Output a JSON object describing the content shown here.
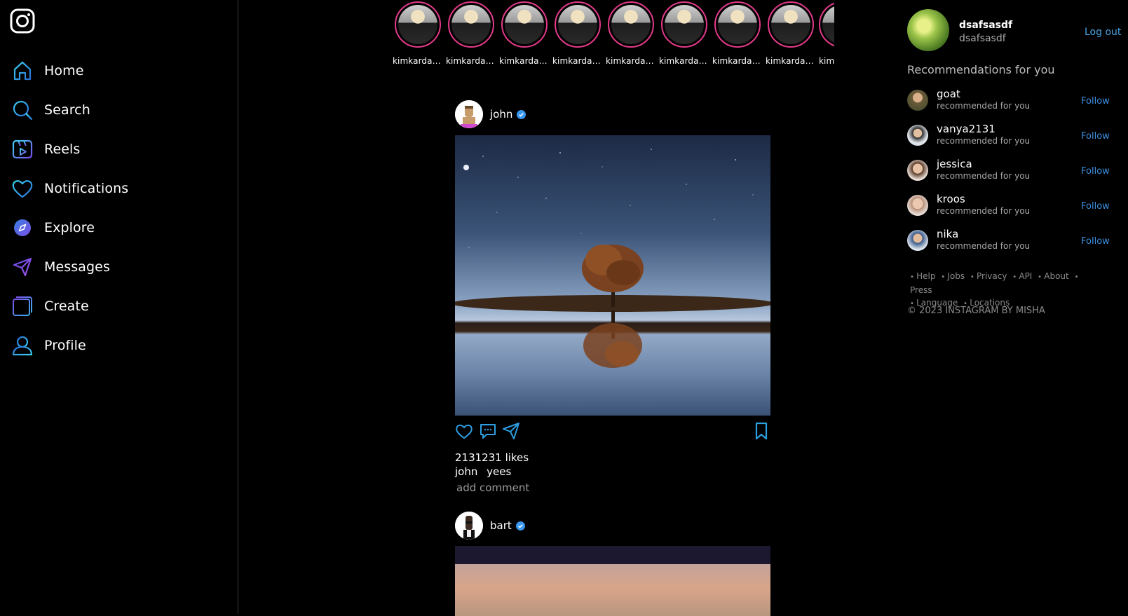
{
  "app": {
    "title": "Instagram"
  },
  "colors": {
    "accent": "#2d9ee0",
    "verified": "#3897f0",
    "story_ring": "#e23a8a",
    "link": "#4aa3e6"
  },
  "nav": [
    {
      "label": "Home",
      "icon": "home-icon"
    },
    {
      "label": "Search",
      "icon": "search-icon"
    },
    {
      "label": "Reels",
      "icon": "reels-icon"
    },
    {
      "label": "Notifications",
      "icon": "heart-icon"
    },
    {
      "label": "Explore",
      "icon": "compass-icon"
    },
    {
      "label": "Messages",
      "icon": "send-icon"
    },
    {
      "label": "Create",
      "icon": "plus-square-icon"
    },
    {
      "label": "Profile",
      "icon": "user-icon"
    }
  ],
  "stories": [
    {
      "name": "kimkardas..."
    },
    {
      "name": "kimkardas..."
    },
    {
      "name": "kimkardas..."
    },
    {
      "name": "kimkardas..."
    },
    {
      "name": "kimkardas..."
    },
    {
      "name": "kimkardas..."
    },
    {
      "name": "kimkardas..."
    },
    {
      "name": "kimkardas..."
    },
    {
      "name": "kim"
    }
  ],
  "posts": [
    {
      "username": "john",
      "likes": "2131231 likes",
      "caption_user": "john",
      "caption_text": "yees",
      "comment_placeholder": "add comment"
    },
    {
      "username": "bart"
    }
  ],
  "sidebar_right": {
    "username": "dsafsasdf",
    "handle": "dsafsasdf",
    "logout": "Log out",
    "recommendations_title": "Recommendations for you",
    "recommendations": [
      {
        "name": "goat",
        "sub": "recommended for you",
        "action": "Follow"
      },
      {
        "name": "vanya2131",
        "sub": "recommended for you",
        "action": "Follow"
      },
      {
        "name": "jessica",
        "sub": "recommended for you",
        "action": "Follow"
      },
      {
        "name": "kroos",
        "sub": "recommended for you",
        "action": "Follow"
      },
      {
        "name": "nika",
        "sub": "recommended for you",
        "action": "Follow"
      }
    ],
    "footer_links": [
      "Help",
      "Jobs",
      "Privacy",
      "API",
      "About",
      "Press",
      "Language",
      "Locations"
    ],
    "copyright": "© 2023 INSTAGRAM BY MISHA"
  }
}
